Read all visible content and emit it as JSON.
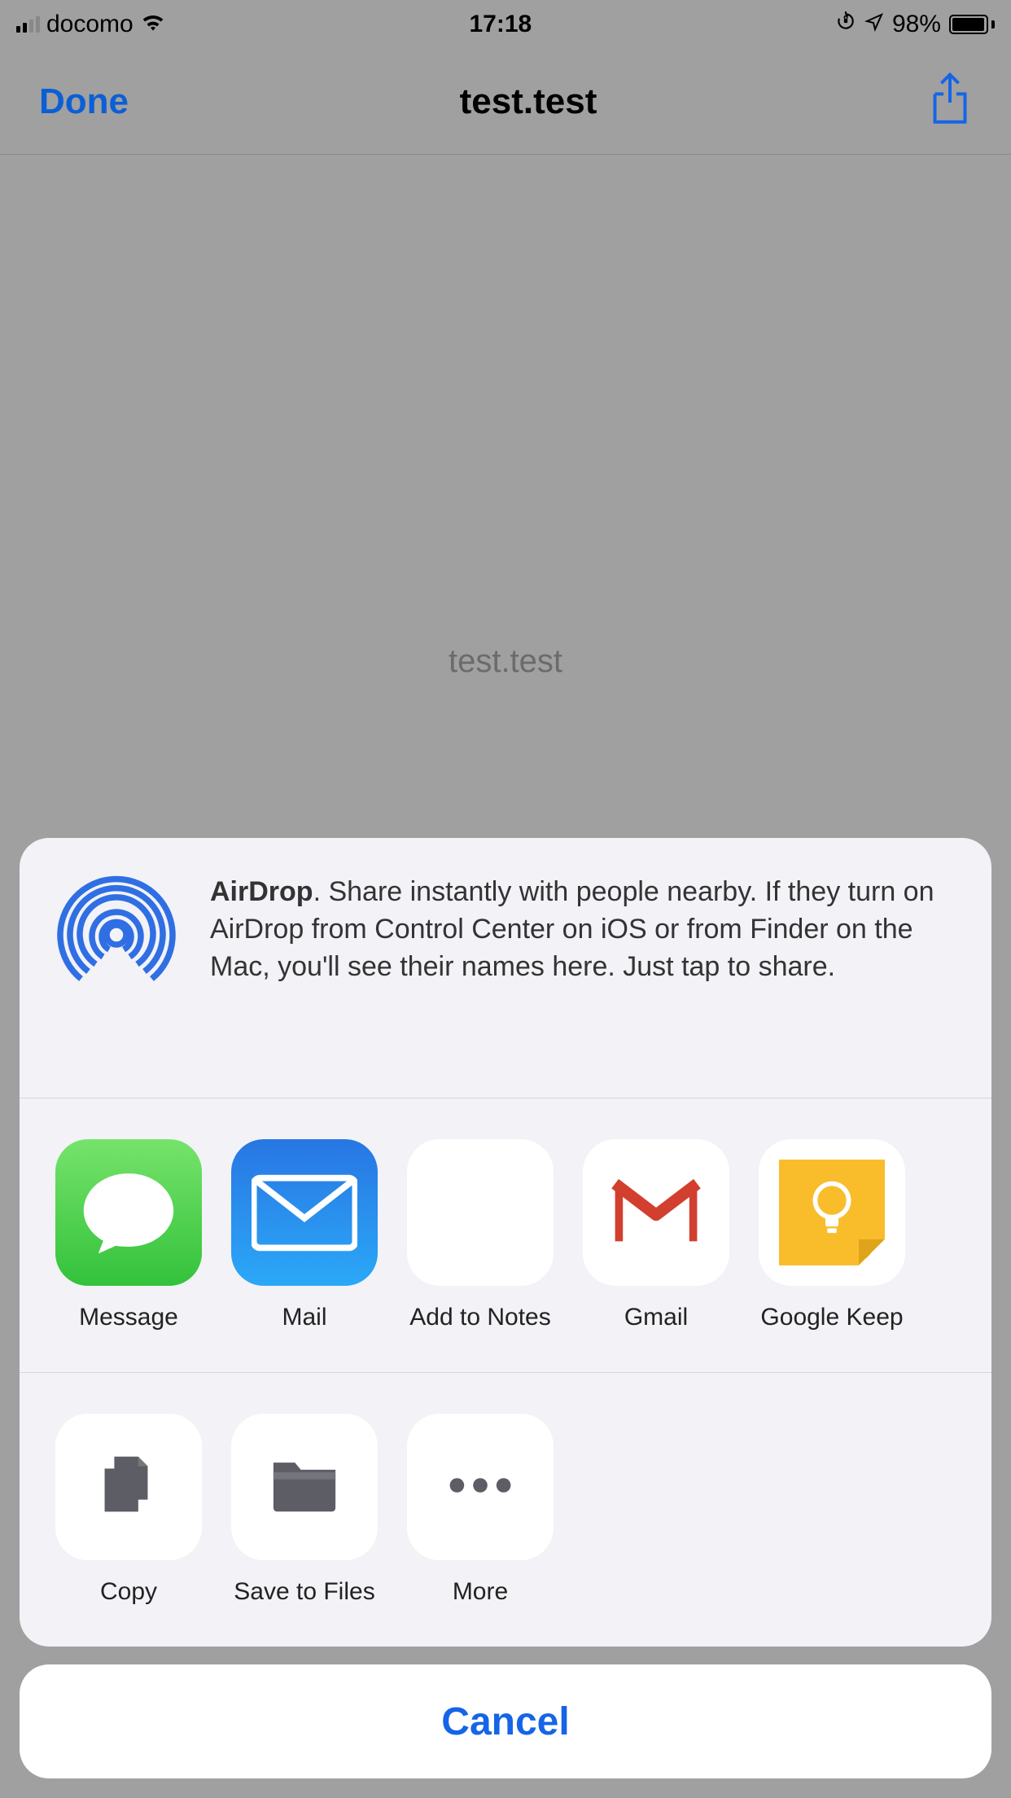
{
  "status": {
    "carrier": "docomo",
    "time": "17:18",
    "battery_pct": "98%"
  },
  "nav": {
    "done": "Done",
    "title": "test.test"
  },
  "content": {
    "filename": "test.test"
  },
  "sheet": {
    "airdrop_title": "AirDrop",
    "airdrop_body": ". Share instantly with people nearby. If they turn on AirDrop from Control Center on iOS or from Finder on the Mac, you'll see their names here. Just tap to share.",
    "apps": [
      {
        "label": "Message"
      },
      {
        "label": "Mail"
      },
      {
        "label": "Add to Notes"
      },
      {
        "label": "Gmail"
      },
      {
        "label": "Google Keep"
      }
    ],
    "actions": [
      {
        "label": "Copy"
      },
      {
        "label": "Save to Files"
      },
      {
        "label": "More"
      }
    ],
    "cancel": "Cancel"
  }
}
